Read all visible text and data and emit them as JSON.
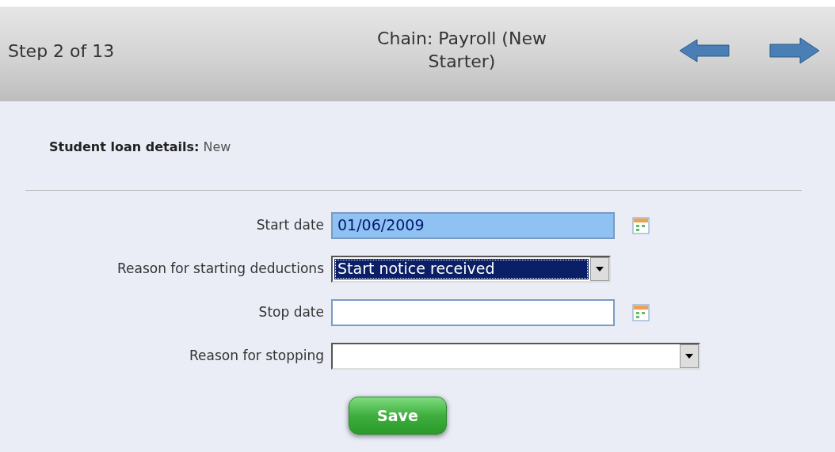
{
  "header": {
    "step": "Step 2 of 13",
    "title": "Chain: Payroll (New Starter)"
  },
  "section": {
    "label": "Student loan details:",
    "value": "New"
  },
  "fields": [
    {
      "kind": "date",
      "label": "Start date",
      "value": "01/06/2009",
      "highlighted": true
    },
    {
      "kind": "select",
      "label": "Reason for starting deductions",
      "value": "Start notice received",
      "highlighted": true,
      "wide": false
    },
    {
      "kind": "date",
      "label": "Stop date",
      "highlighted": false
    },
    {
      "kind": "select",
      "label": "Reason for stopping",
      "highlighted": false,
      "wide": true
    }
  ],
  "save_button": "Save"
}
